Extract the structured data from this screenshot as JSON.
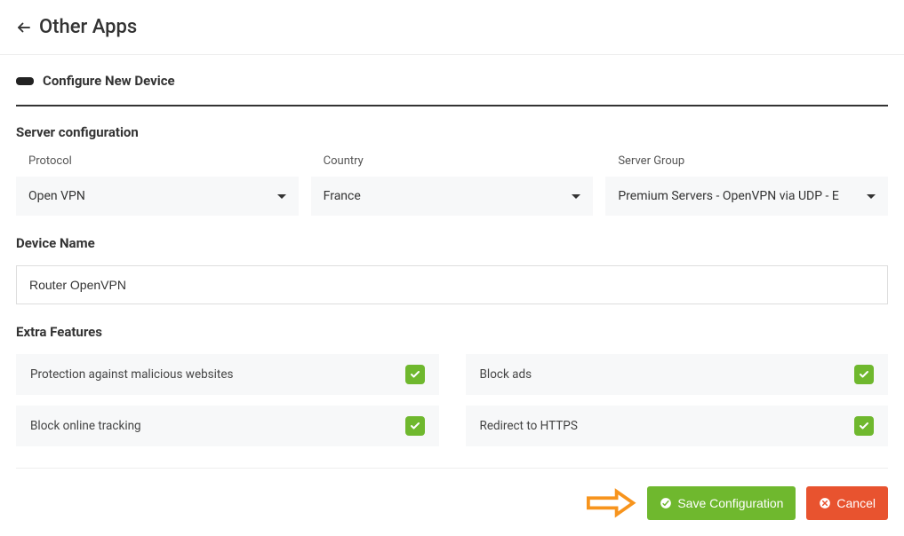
{
  "header": {
    "title": "Other Apps"
  },
  "page": {
    "heading": "Configure New Device"
  },
  "server_configuration": {
    "title": "Server configuration",
    "protocol": {
      "label": "Protocol",
      "value": "Open VPN"
    },
    "country": {
      "label": "Country",
      "value": "France"
    },
    "server_group": {
      "label": "Server Group",
      "value": "Premium Servers - OpenVPN via UDP - E"
    }
  },
  "device_name": {
    "title": "Device Name",
    "value": "Router OpenVPN"
  },
  "extra_features": {
    "title": "Extra Features",
    "items": [
      {
        "label": "Protection against malicious websites",
        "enabled": true
      },
      {
        "label": "Block ads",
        "enabled": true
      },
      {
        "label": "Block online tracking",
        "enabled": true
      },
      {
        "label": "Redirect to HTTPS",
        "enabled": true
      }
    ]
  },
  "actions": {
    "save": "Save Configuration",
    "cancel": "Cancel"
  },
  "colors": {
    "success": "#6fb82e",
    "danger": "#e8532f",
    "highlight": "#f7941d"
  }
}
